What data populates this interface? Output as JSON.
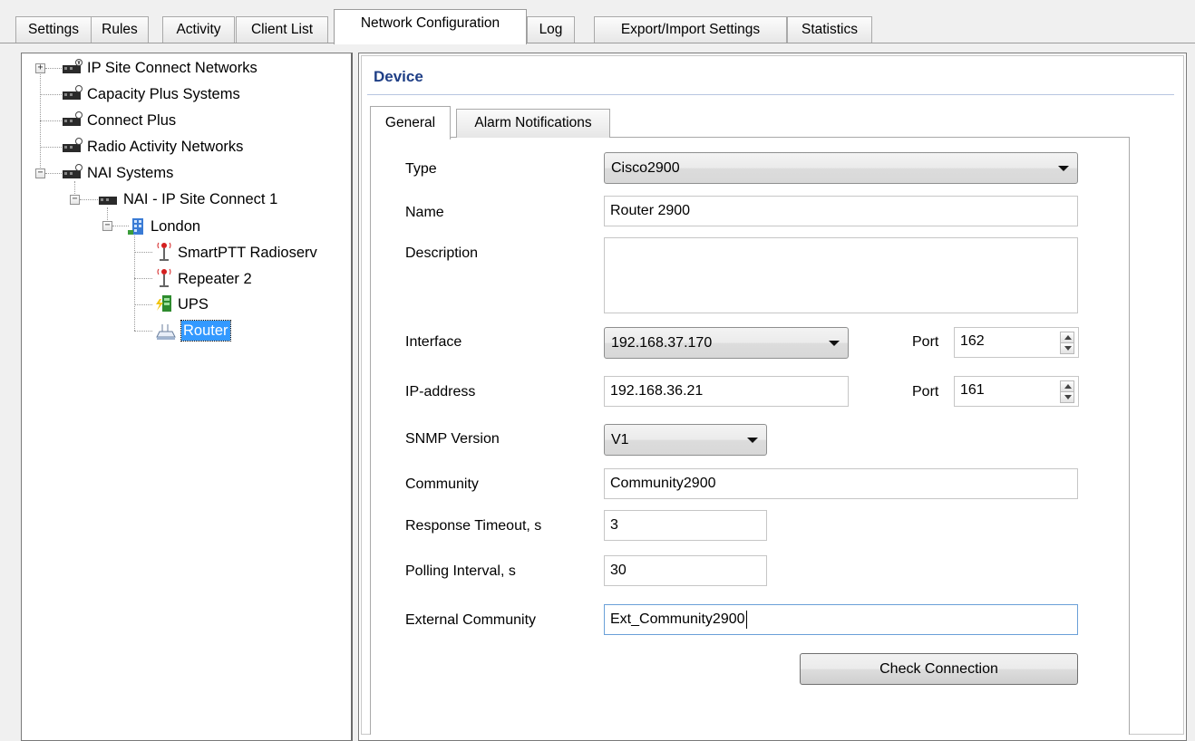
{
  "main_tabs": [
    {
      "label": "Settings"
    },
    {
      "label": "Rules"
    },
    {
      "label": "Activity"
    },
    {
      "label": "Client List"
    },
    {
      "label": "Network Configuration"
    },
    {
      "label": "Log"
    },
    {
      "label": "Export/Import Settings"
    },
    {
      "label": "Statistics"
    }
  ],
  "active_main_tab": "Network Configuration",
  "tree": {
    "items": [
      {
        "label": "IP Site Connect Networks",
        "icon": "network-icon",
        "expander": "+"
      },
      {
        "label": "Capacity Plus Systems",
        "icon": "network-icon"
      },
      {
        "label": "Connect Plus",
        "icon": "network-icon"
      },
      {
        "label": "Radio Activity Networks",
        "icon": "network-icon"
      },
      {
        "label": "NAI Systems",
        "icon": "network-icon",
        "expander": "−"
      },
      {
        "label": "NAI - IP Site Connect 1",
        "icon": "network-icon",
        "expander": "−"
      },
      {
        "label": "London",
        "icon": "building-icon",
        "expander": "−"
      },
      {
        "label": "SmartPTT Radioserv",
        "icon": "radio-tower-icon"
      },
      {
        "label": "Repeater 2",
        "icon": "radio-tower-icon"
      },
      {
        "label": "UPS",
        "icon": "battery-icon"
      },
      {
        "label": "Router",
        "icon": "router-icon",
        "selected": true
      }
    ]
  },
  "device": {
    "title": "Device",
    "subtabs": [
      {
        "label": "General"
      },
      {
        "label": "Alarm Notifications"
      }
    ],
    "active_subtab": "General",
    "form": {
      "type_label": "Type",
      "type_value": "Cisco2900",
      "name_label": "Name",
      "name_value": "Router 2900",
      "description_label": "Description",
      "description_value": "",
      "interface_label": "Interface",
      "interface_value": "192.168.37.170",
      "interface_port_label": "Port",
      "interface_port_value": "162",
      "ip_label": "IP-address",
      "ip_value": "192.168.36.21",
      "ip_port_label": "Port",
      "ip_port_value": "161",
      "snmp_label": "SNMP Version",
      "snmp_value": "V1",
      "community_label": "Community",
      "community_value": "Community2900",
      "timeout_label": "Response Timeout, s",
      "timeout_value": "3",
      "polling_label": "Polling Interval, s",
      "polling_value": "30",
      "ext_community_label": "External Community",
      "ext_community_value": "Ext_Community2900",
      "check_button": "Check Connection"
    }
  },
  "colors": {
    "selection": "#3399ff",
    "title": "#1f3f86"
  }
}
